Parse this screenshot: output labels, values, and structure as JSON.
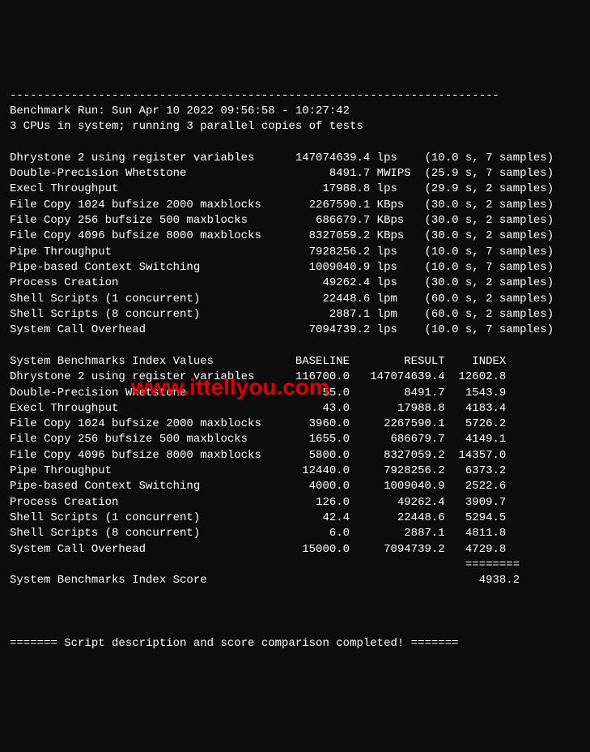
{
  "chart_data": {
    "type": "table",
    "title": "System Benchmarks Index Values",
    "columns": [
      "BASELINE",
      "RESULT",
      "INDEX"
    ],
    "rows": [
      {
        "name": "Dhrystone 2 using register variables",
        "baseline": 116700.0,
        "result": 147074639.4,
        "index": 12602.8
      },
      {
        "name": "Double-Precision Whetstone",
        "baseline": 55.0,
        "result": 8491.7,
        "index": 1543.9
      },
      {
        "name": "Execl Throughput",
        "baseline": 43.0,
        "result": 17988.8,
        "index": 4183.4
      },
      {
        "name": "File Copy 1024 bufsize 2000 maxblocks",
        "baseline": 3960.0,
        "result": 2267590.1,
        "index": 5726.2
      },
      {
        "name": "File Copy 256 bufsize 500 maxblocks",
        "baseline": 1655.0,
        "result": 686679.7,
        "index": 4149.1
      },
      {
        "name": "File Copy 4096 bufsize 8000 maxblocks",
        "baseline": 5800.0,
        "result": 8327059.2,
        "index": 14357.0
      },
      {
        "name": "Pipe Throughput",
        "baseline": 12440.0,
        "result": 7928256.2,
        "index": 6373.2
      },
      {
        "name": "Pipe-based Context Switching",
        "baseline": 4000.0,
        "result": 1009040.9,
        "index": 2522.6
      },
      {
        "name": "Process Creation",
        "baseline": 126.0,
        "result": 49262.4,
        "index": 3909.7
      },
      {
        "name": "Shell Scripts (1 concurrent)",
        "baseline": 42.4,
        "result": 22448.6,
        "index": 5294.5
      },
      {
        "name": "Shell Scripts (8 concurrent)",
        "baseline": 6.0,
        "result": 2887.1,
        "index": 4811.8
      },
      {
        "name": "System Call Overhead",
        "baseline": 15000.0,
        "result": 7094739.2,
        "index": 4729.8
      }
    ],
    "score_label": "System Benchmarks Index Score",
    "score": 4938.2
  },
  "divider_top": "------------------------------------------------------------------------",
  "header_line1": "Benchmark Run: Sun Apr 10 2022 09:56:58 - 10:27:42",
  "header_line2": "3 CPUs in system; running 3 parallel copies of tests",
  "raw_results": [
    {
      "name": "Dhrystone 2 using register variables",
      "val": "147074639.4",
      "unit": "lps",
      "meta": "(10.0 s, 7 samples)"
    },
    {
      "name": "Double-Precision Whetstone",
      "val": "8491.7",
      "unit": "MWIPS",
      "meta": "(25.9 s, 7 samples)"
    },
    {
      "name": "Execl Throughput",
      "val": "17988.8",
      "unit": "lps",
      "meta": "(29.9 s, 2 samples)"
    },
    {
      "name": "File Copy 1024 bufsize 2000 maxblocks",
      "val": "2267590.1",
      "unit": "KBps",
      "meta": "(30.0 s, 2 samples)"
    },
    {
      "name": "File Copy 256 bufsize 500 maxblocks",
      "val": "686679.7",
      "unit": "KBps",
      "meta": "(30.0 s, 2 samples)"
    },
    {
      "name": "File Copy 4096 bufsize 8000 maxblocks",
      "val": "8327059.2",
      "unit": "KBps",
      "meta": "(30.0 s, 2 samples)"
    },
    {
      "name": "Pipe Throughput",
      "val": "7928256.2",
      "unit": "lps",
      "meta": "(10.0 s, 7 samples)"
    },
    {
      "name": "Pipe-based Context Switching",
      "val": "1009040.9",
      "unit": "lps",
      "meta": "(10.0 s, 7 samples)"
    },
    {
      "name": "Process Creation",
      "val": "49262.4",
      "unit": "lps",
      "meta": "(30.0 s, 2 samples)"
    },
    {
      "name": "Shell Scripts (1 concurrent)",
      "val": "22448.6",
      "unit": "lpm",
      "meta": "(60.0 s, 2 samples)"
    },
    {
      "name": "Shell Scripts (8 concurrent)",
      "val": "2887.1",
      "unit": "lpm",
      "meta": "(60.0 s, 2 samples)"
    },
    {
      "name": "System Call Overhead",
      "val": "7094739.2",
      "unit": "lps",
      "meta": "(10.0 s, 7 samples)"
    }
  ],
  "idx_header_label": "System Benchmarks Index Values",
  "col1": "BASELINE",
  "col2": "RESULT",
  "col3": "INDEX",
  "idx_rows": [
    {
      "name": "Dhrystone 2 using register variables",
      "baseline": "116700.0",
      "result": "147074639.4",
      "index": "12602.8"
    },
    {
      "name": "Double-Precision Whetstone",
      "baseline": "55.0",
      "result": "8491.7",
      "index": "1543.9"
    },
    {
      "name": "Execl Throughput",
      "baseline": "43.0",
      "result": "17988.8",
      "index": "4183.4"
    },
    {
      "name": "File Copy 1024 bufsize 2000 maxblocks",
      "baseline": "3960.0",
      "result": "2267590.1",
      "index": "5726.2"
    },
    {
      "name": "File Copy 256 bufsize 500 maxblocks",
      "baseline": "1655.0",
      "result": "686679.7",
      "index": "4149.1"
    },
    {
      "name": "File Copy 4096 bufsize 8000 maxblocks",
      "baseline": "5800.0",
      "result": "8327059.2",
      "index": "14357.0"
    },
    {
      "name": "Pipe Throughput",
      "baseline": "12440.0",
      "result": "7928256.2",
      "index": "6373.2"
    },
    {
      "name": "Pipe-based Context Switching",
      "baseline": "4000.0",
      "result": "1009040.9",
      "index": "2522.6"
    },
    {
      "name": "Process Creation",
      "baseline": "126.0",
      "result": "49262.4",
      "index": "3909.7"
    },
    {
      "name": "Shell Scripts (1 concurrent)",
      "baseline": "42.4",
      "result": "22448.6",
      "index": "5294.5"
    },
    {
      "name": "Shell Scripts (8 concurrent)",
      "baseline": "6.0",
      "result": "2887.1",
      "index": "4811.8"
    },
    {
      "name": "System Call Overhead",
      "baseline": "15000.0",
      "result": "7094739.2",
      "index": "4729.8"
    }
  ],
  "idx_divider": "                                                                   ========",
  "score_line": "System Benchmarks Index Score                                        4938.2",
  "footer": "======= Script description and score comparison completed! =======",
  "watermark": "www.ittellyou.com"
}
